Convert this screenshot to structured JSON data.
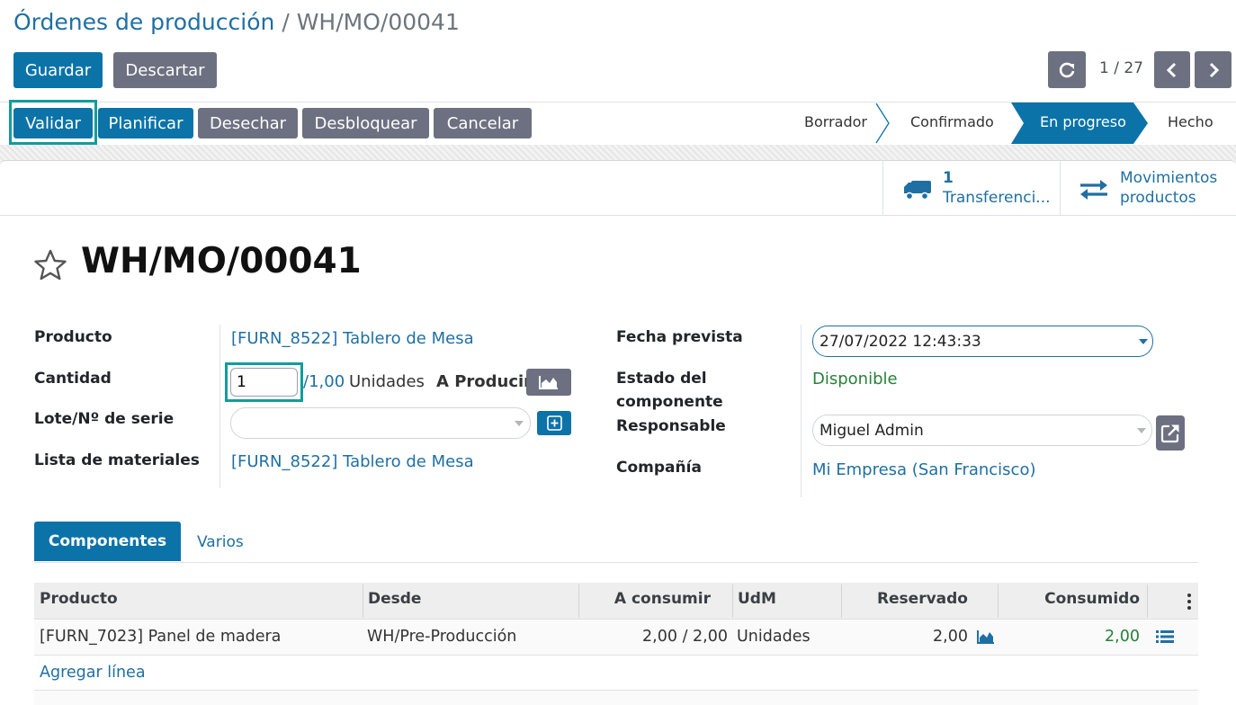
{
  "breadcrumb": {
    "parent": "Órdenes de producción",
    "separator": "/",
    "current": "WH/MO/00041"
  },
  "control": {
    "save_label": "Guardar",
    "discard_label": "Descartar",
    "pager": "1 / 27"
  },
  "actions": [
    "Validar",
    "Planificar",
    "Desechar",
    "Desbloquear",
    "Cancelar"
  ],
  "stages": [
    {
      "label": "Borrador",
      "active": false
    },
    {
      "label": "Confirmado",
      "active": false
    },
    {
      "label": "En progreso",
      "active": true
    },
    {
      "label": "Hecho",
      "active": false
    }
  ],
  "smart_buttons": {
    "transfers": {
      "count": "1",
      "label": "Transferenci...",
      "icon": "truck-icon"
    },
    "moves": {
      "line1": "Movimientos",
      "line2": "productos",
      "icon": "exchange-icon"
    }
  },
  "record": {
    "title": "WH/MO/00041"
  },
  "fields": {
    "product_label": "Producto",
    "product_value": "[FURN_8522] Tablero de Mesa",
    "quantity_label": "Cantidad",
    "quantity_value": "1",
    "quantity_total": "/1,00",
    "quantity_uom": "Unidades",
    "to_produce": "A Producir",
    "lot_label": "Lote/Nº de serie",
    "lot_value": "",
    "bom_label": "Lista de materiales",
    "bom_value": "[FURN_8522] Tablero de Mesa",
    "date_label": "Fecha prevista",
    "date_value": "27/07/2022 12:43:33",
    "component_status_label_1": "Estado del",
    "component_status_label_2": "componente",
    "component_status_value": "Disponible",
    "responsible_label": "Responsable",
    "responsible_value": "Miguel Admin",
    "company_label": "Compañía",
    "company_value": "Mi Empresa (San Francisco)"
  },
  "tabs": [
    {
      "label": "Componentes",
      "active": true
    },
    {
      "label": "Varios",
      "active": false
    }
  ],
  "table": {
    "headers": [
      "Producto",
      "Desde",
      "A consumir",
      "UdM",
      "Reservado",
      "Consumido"
    ],
    "rows": [
      {
        "product": "[FURN_7023] Panel de madera",
        "from": "WH/Pre-Producción",
        "to_consume": "2,00 / 2,00",
        "uom": "Unidades",
        "reserved": "2,00",
        "consumed": "2,00"
      }
    ],
    "add_line": "Agregar línea"
  },
  "colors": {
    "primary": "#0b73a8",
    "secondary": "#6c7080",
    "link": "#1f6fa3",
    "success": "#28803a",
    "highlight": "#129c9c"
  }
}
